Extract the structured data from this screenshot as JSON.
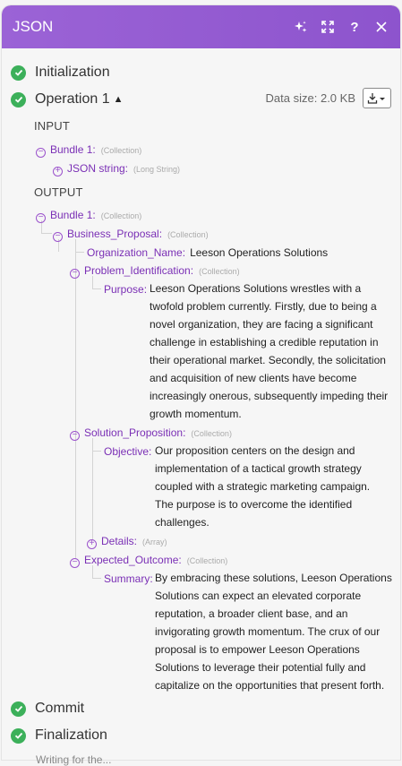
{
  "header": {
    "title": "JSON"
  },
  "phases": {
    "initialization": "Initialization",
    "operation": "Operation 1",
    "commit": "Commit",
    "finalization": "Finalization"
  },
  "datasize": "Data size: 2.0 KB",
  "input": {
    "heading": "INPUT",
    "bundle_key": "Bundle 1:",
    "bundle_type": "(Collection)",
    "json_key": "JSON string:",
    "json_type": "(Long String)"
  },
  "output": {
    "heading": "OUTPUT",
    "bundle_key": "Bundle 1:",
    "bundle_type": "(Collection)",
    "bp_key": "Business_Proposal:",
    "bp_type": "(Collection)",
    "org_key": "Organization_Name:",
    "org_val": "Leeson Operations Solutions",
    "prob_key": "Problem_Identification:",
    "prob_type": "(Collection)",
    "purpose_key": "Purpose:",
    "purpose_lines": [
      "Leeson Operations Solutions wrestles with a",
      "twofold problem currently. Firstly, due to being a",
      "novel organization, they are facing a significant",
      "challenge in establishing a credible reputation in",
      "their operational market. Secondly, the solicitation",
      "and acquisition of new clients have become",
      "increasingly onerous, subsequently impeding their",
      "growth momentum."
    ],
    "sol_key": "Solution_Proposition:",
    "sol_type": "(Collection)",
    "objective_key": "Objective:",
    "objective_lines": [
      "Our proposition centers on the design and",
      "implementation of a tactical growth strategy",
      "coupled with a strategic marketing campaign.",
      "The purpose is to overcome the identified",
      "challenges."
    ],
    "details_key": "Details:",
    "details_type": "(Array)",
    "exp_key": "Expected_Outcome:",
    "exp_type": "(Collection)",
    "summary_key": "Summary:",
    "summary_lines": [
      "By embracing these solutions, Leeson Operations",
      "Solutions can expect an elevated corporate",
      "reputation, a broader client base, and an",
      "invigorating growth momentum. The crux of our",
      "proposal is to empower Leeson Operations",
      "Solutions to leverage their potential fully and",
      "capitalize on the opportunities that present forth."
    ]
  },
  "cutoff_text": "Writing for the..."
}
